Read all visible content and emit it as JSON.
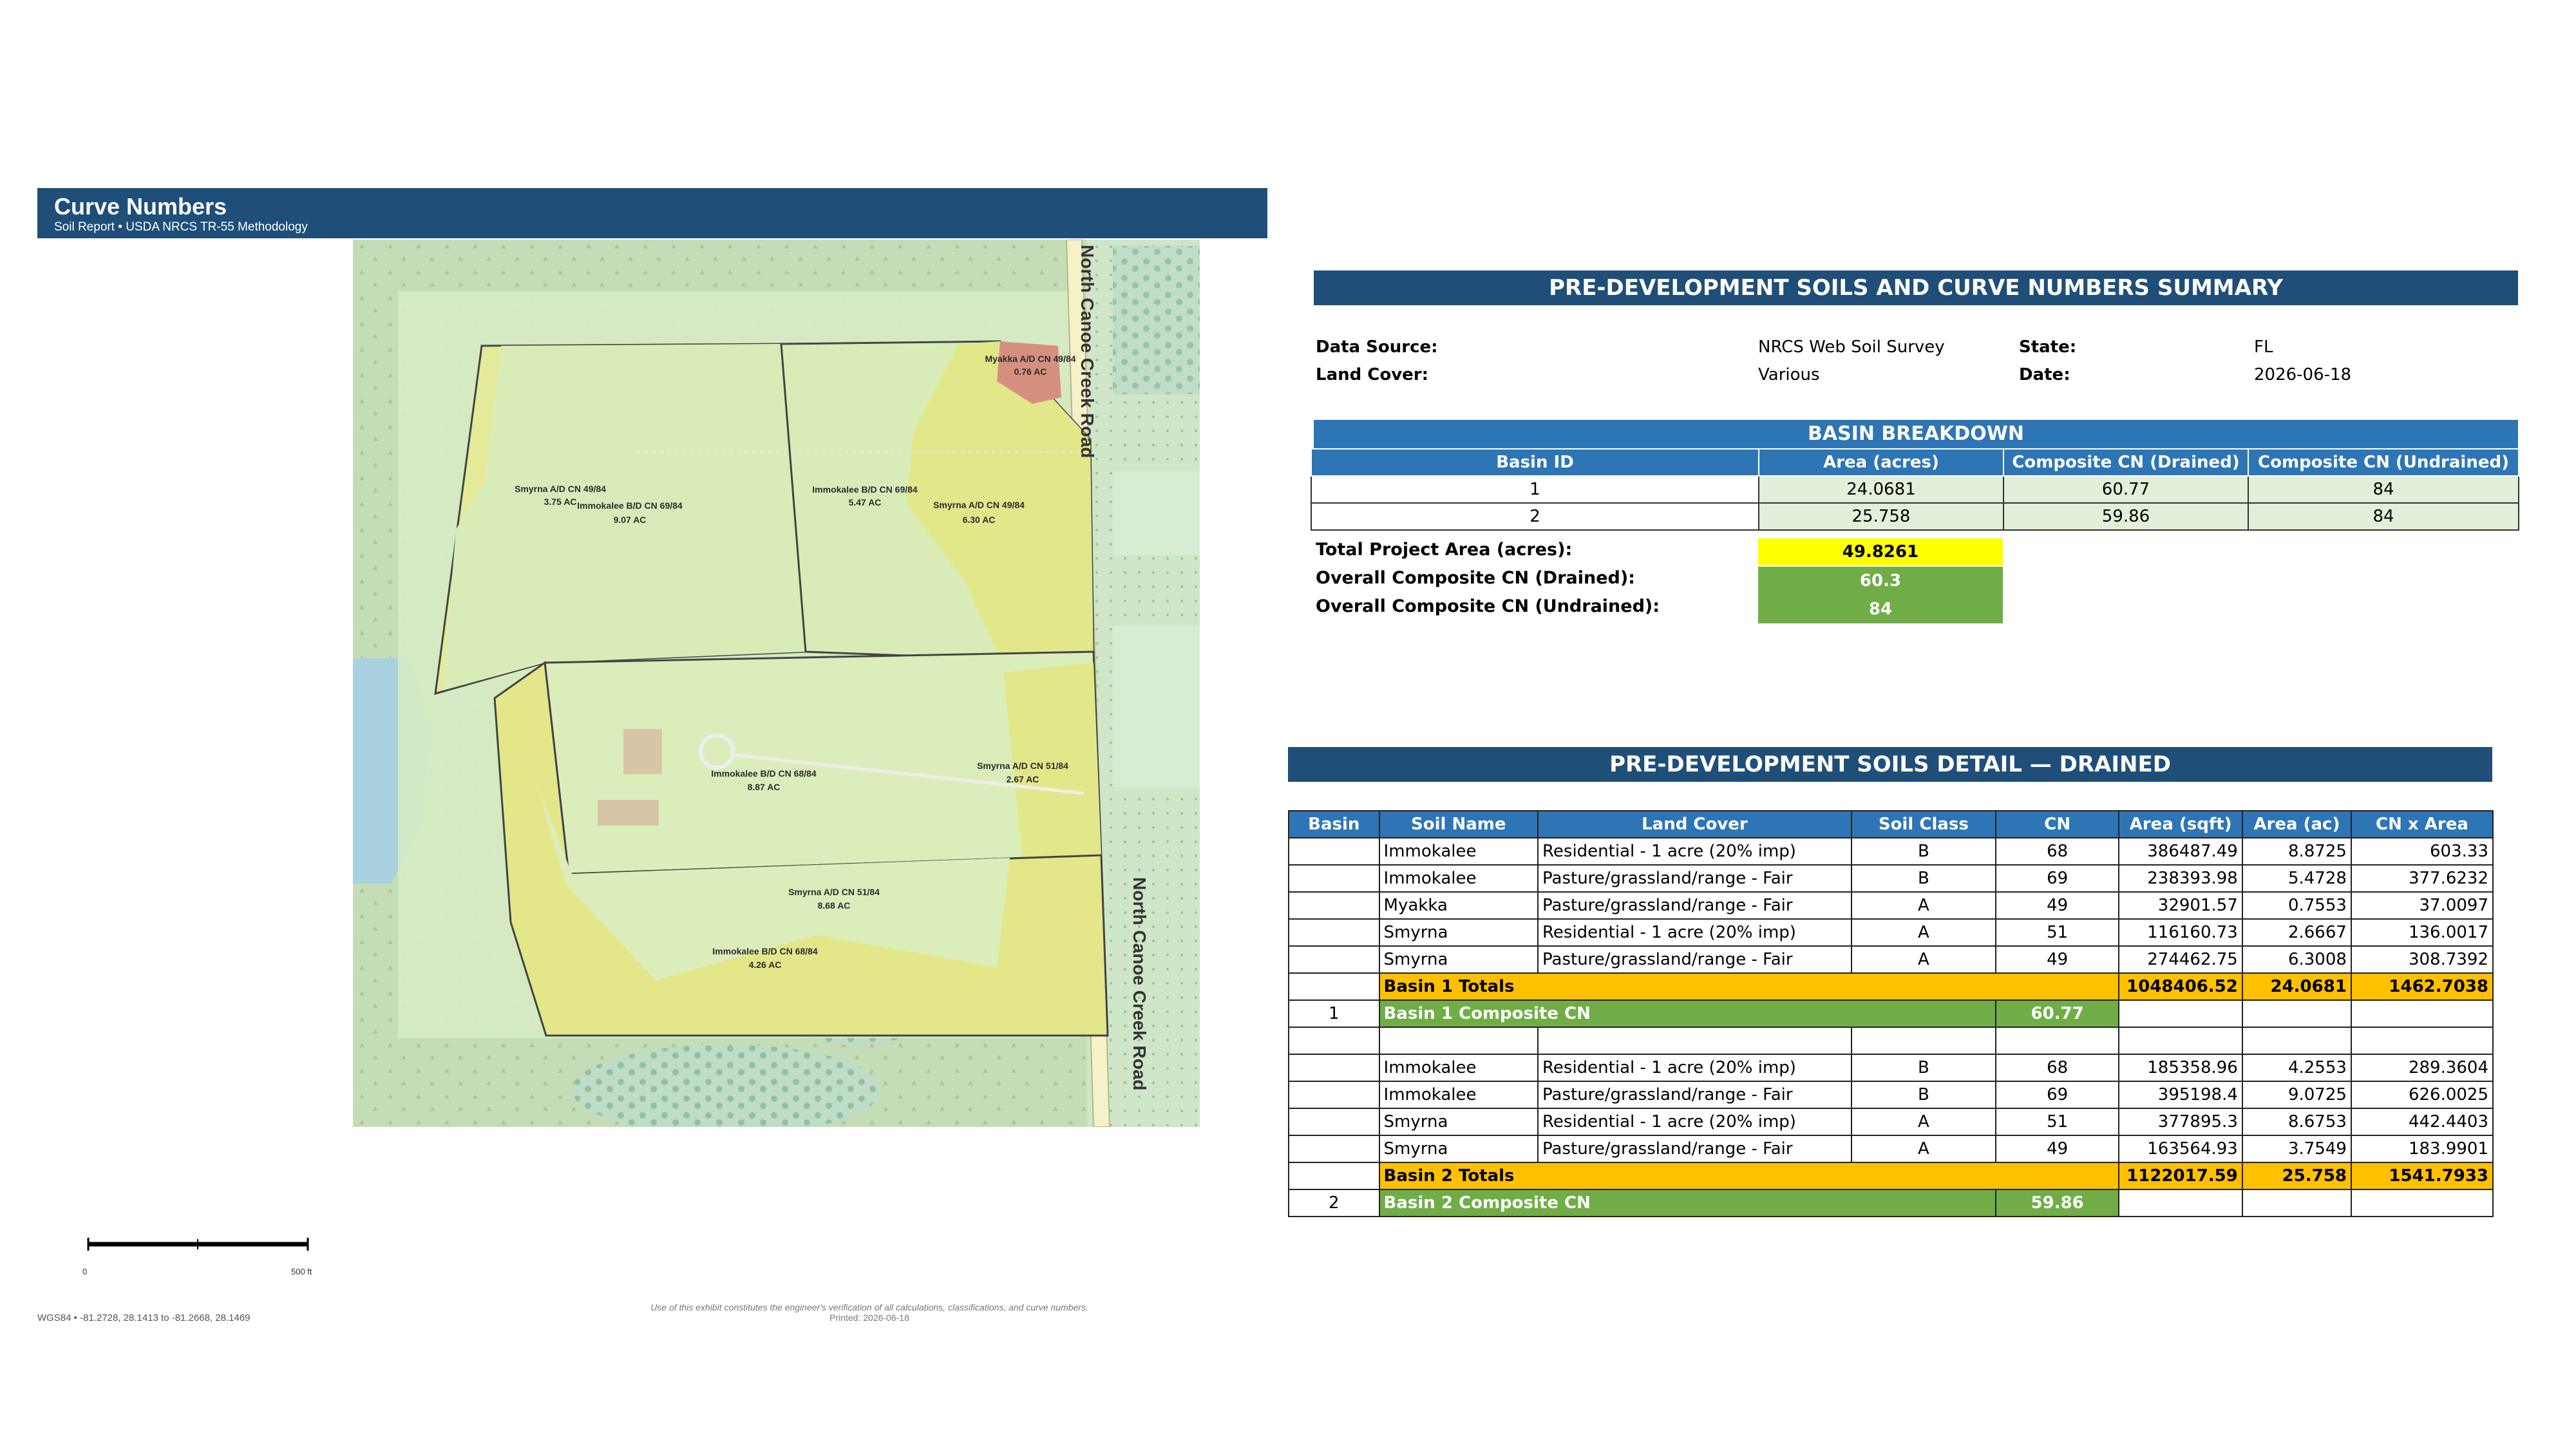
{
  "header": {
    "title": "Curve Numbers",
    "subtitle": "Soil Report  •  USDA NRCS TR-55 Methodology"
  },
  "map": {
    "road_label": "North Canoe Creek Road",
    "labels": [
      {
        "name": "Myakka A/D CN 49/84",
        "area": "0.76 AC"
      },
      {
        "name": "Smyrna A/D CN 49/84",
        "area": "3.75 AC"
      },
      {
        "name": "Immokalee B/D CN 69/84",
        "area": "9.07 AC"
      },
      {
        "name": "Immokalee B/D CN 69/84",
        "area": "5.47 AC"
      },
      {
        "name": "Smyrna A/D CN 49/84",
        "area": "6.30 AC"
      },
      {
        "name": "Immokalee B/D CN 68/84",
        "area": "8.87 AC"
      },
      {
        "name": "Smyrna A/D CN 51/84",
        "area": "2.67 AC"
      },
      {
        "name": "Smyrna A/D CN 51/84",
        "area": "8.68 AC"
      },
      {
        "name": "Immokalee B/D CN 68/84",
        "area": "4.26 AC"
      }
    ],
    "scale_start": "0",
    "scale_end": "500 ft",
    "disclaimer": "Use of this exhibit constitutes the engineer's verification of all calculations, classifications, and curve numbers.",
    "printed": "Printed: 2026-06-18",
    "coords": "WGS84 • -81.2728, 28.1413  to  -81.2668, 28.1469"
  },
  "summary": {
    "title": "PRE-DEVELOPMENT SOILS AND CURVE NUMBERS SUMMARY",
    "data_source_label": "Data Source:",
    "data_source": "NRCS Web Soil Survey",
    "land_cover_label": "Land Cover:",
    "land_cover": "Various",
    "state_label": "State:",
    "state": "FL",
    "date_label": "Date:",
    "date": "2026-06-18"
  },
  "basin_breakdown": {
    "title": "BASIN BREAKDOWN",
    "columns": [
      "Basin ID",
      "Area (acres)",
      "Composite CN (Drained)",
      "Composite CN (Undrained)"
    ],
    "rows": [
      [
        "1",
        "24.0681",
        "60.77",
        "84"
      ],
      [
        "2",
        "25.758",
        "59.86",
        "84"
      ]
    ],
    "total_area_label": "Total Project Area (acres):",
    "total_area": "49.8261",
    "drained_label": "Overall Composite CN (Drained):",
    "drained": "60.3",
    "undrained_label": "Overall Composite CN (Undrained):",
    "undrained": "84"
  },
  "detail": {
    "title": "PRE-DEVELOPMENT SOILS DETAIL — DRAINED",
    "columns": [
      "Basin",
      "Soil Name",
      "Land Cover",
      "Soil Class",
      "CN",
      "Area (sqft)",
      "Area (ac)",
      "CN x Area"
    ],
    "basin1_rows": [
      [
        "Immokalee",
        "Residential - 1 acre (20% imp)",
        "B",
        "68",
        "386487.49",
        "8.8725",
        "603.33"
      ],
      [
        "Immokalee",
        "Pasture/grassland/range - Fair",
        "B",
        "69",
        "238393.98",
        "5.4728",
        "377.6232"
      ],
      [
        "Myakka",
        "Pasture/grassland/range - Fair",
        "A",
        "49",
        "32901.57",
        "0.7553",
        "37.0097"
      ],
      [
        "Smyrna",
        "Residential - 1 acre (20% imp)",
        "A",
        "51",
        "116160.73",
        "2.6667",
        "136.0017"
      ],
      [
        "Smyrna",
        "Pasture/grassland/range - Fair",
        "A",
        "49",
        "274462.75",
        "6.3008",
        "308.7392"
      ]
    ],
    "basin1_totals": {
      "label": "Basin 1 Totals",
      "sqft": "1048406.52",
      "ac": "24.0681",
      "cnxa": "1462.7038"
    },
    "basin1_comp": {
      "id": "1",
      "label": "Basin 1 Composite CN",
      "value": "60.77"
    },
    "basin2_rows": [
      [
        "Immokalee",
        "Residential - 1 acre (20% imp)",
        "B",
        "68",
        "185358.96",
        "4.2553",
        "289.3604"
      ],
      [
        "Immokalee",
        "Pasture/grassland/range - Fair",
        "B",
        "69",
        "395198.4",
        "9.0725",
        "626.0025"
      ],
      [
        "Smyrna",
        "Residential - 1 acre (20% imp)",
        "A",
        "51",
        "377895.3",
        "8.6753",
        "442.4403"
      ],
      [
        "Smyrna",
        "Pasture/grassland/range - Fair",
        "A",
        "49",
        "163564.93",
        "3.7549",
        "183.9901"
      ]
    ],
    "basin2_totals": {
      "label": "Basin 2 Totals",
      "sqft": "1122017.59",
      "ac": "25.758",
      "cnxa": "1541.7933"
    },
    "basin2_comp": {
      "id": "2",
      "label": "Basin 2 Composite CN",
      "value": "59.86"
    }
  }
}
